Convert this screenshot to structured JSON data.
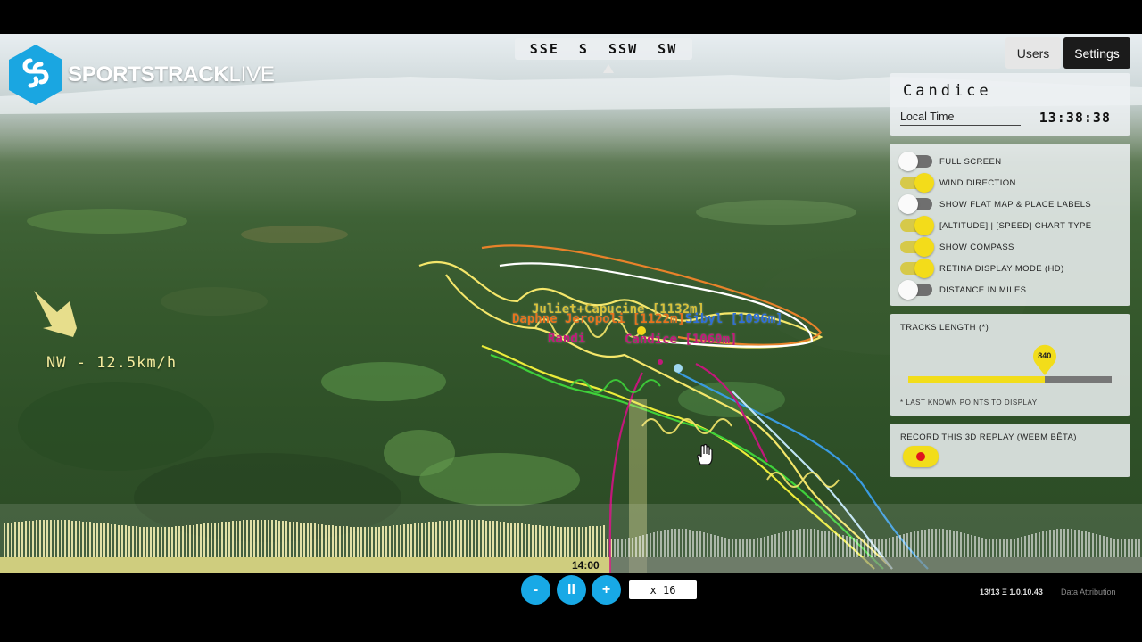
{
  "brand": {
    "name_bold": "SPORTSTRACK",
    "name_light": "LIVE"
  },
  "compass": {
    "text": "SSE  S  SSW  SW"
  },
  "header": {
    "users_label": "Users",
    "settings_label": "Settings"
  },
  "user_panel": {
    "name": "Candice",
    "time_label": "Local Time",
    "time_value": "13:38:38"
  },
  "options": [
    {
      "label": "FULL SCREEN",
      "on": false
    },
    {
      "label": "WIND DIRECTION",
      "on": true
    },
    {
      "label": "SHOW FLAT MAP & PLACE LABELS",
      "on": false
    },
    {
      "label": "[ALTITUDE] | [SPEED] CHART TYPE",
      "on": true
    },
    {
      "label": "SHOW COMPASS",
      "on": true
    },
    {
      "label": "RETINA DISPLAY MODE (HD)",
      "on": true
    },
    {
      "label": "DISTANCE IN MILES",
      "on": false
    }
  ],
  "tracks": {
    "title": "TRACKS LENGTH (*)",
    "value": "840",
    "fraction": 0.67,
    "note": "* LAST KNOWN POINTS TO DISPLAY"
  },
  "record": {
    "title": "RECORD THIS 3D REPLAY (WEBM BÊTA)"
  },
  "wind": {
    "label": "NW - 12.5km/h"
  },
  "pilots": [
    {
      "text": "Juliet+Capucine [1132m]",
      "color": "#d8c23a"
    },
    {
      "text": "Daphne Jeropoli [1122m]",
      "color": "#e8731c"
    },
    {
      "text": "Sibyl [1096m]",
      "color": "#2f6fd8"
    },
    {
      "text": "Randi",
      "color": "#c2187a"
    },
    {
      "text": "Candice [1060m]",
      "color": "#c2187a"
    }
  ],
  "timeline": {
    "time_marker": "14:00",
    "progress": 0.535
  },
  "playback": {
    "minus": "-",
    "pause": "II",
    "plus": "+",
    "speed": "x 16"
  },
  "footer": {
    "version": "13/13 Ξ 1.0.10.43",
    "attribution": "Data Attribution"
  },
  "colors": {
    "accent_blue": "#18a9e6",
    "accent_yellow": "#f2dd1a",
    "logo_blue": "#1aa6e1"
  }
}
